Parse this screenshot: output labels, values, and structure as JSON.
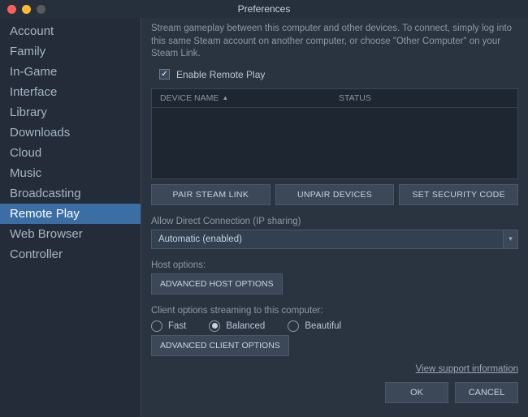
{
  "window": {
    "title": "Preferences"
  },
  "sidebar": {
    "items": [
      {
        "label": "Account"
      },
      {
        "label": "Family"
      },
      {
        "label": "In-Game"
      },
      {
        "label": "Interface"
      },
      {
        "label": "Library"
      },
      {
        "label": "Downloads"
      },
      {
        "label": "Cloud"
      },
      {
        "label": "Music"
      },
      {
        "label": "Broadcasting"
      },
      {
        "label": "Remote Play"
      },
      {
        "label": "Web Browser"
      },
      {
        "label": "Controller"
      }
    ],
    "selected_index": 9
  },
  "main": {
    "description": "Stream gameplay between this computer and other devices. To connect, simply log into this same Steam account on another computer, or choose \"Other Computer\" on your Steam Link.",
    "enable_label": "Enable Remote Play",
    "device_table": {
      "col_name": "DEVICE NAME",
      "col_status": "STATUS",
      "sort_indicator": "▲"
    },
    "buttons": {
      "pair": "PAIR STEAM LINK",
      "unpair": "UNPAIR DEVICES",
      "security": "SET SECURITY CODE"
    },
    "direct_conn": {
      "label": "Allow Direct Connection (IP sharing)",
      "value": "Automatic (enabled)"
    },
    "host": {
      "label": "Host options:",
      "button": "ADVANCED HOST OPTIONS"
    },
    "client": {
      "label": "Client options streaming to this computer:",
      "options": [
        {
          "label": "Fast"
        },
        {
          "label": "Balanced"
        },
        {
          "label": "Beautiful"
        }
      ],
      "selected_index": 1,
      "adv_button": "ADVANCED CLIENT OPTIONS"
    },
    "support_link": "View support information",
    "footer": {
      "ok": "OK",
      "cancel": "CANCEL"
    }
  }
}
